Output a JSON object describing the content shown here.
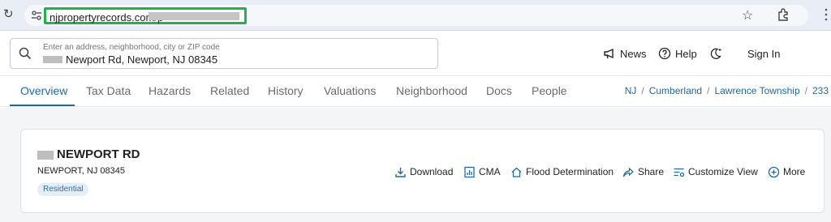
{
  "browser": {
    "url": "njpropertyrecords.com/p"
  },
  "search": {
    "placeholder": "Enter an address, neighborhood, city or ZIP code",
    "value": "Newport Rd, Newport, NJ 08345"
  },
  "header": {
    "news": "News",
    "help": "Help",
    "sign_in": "Sign In"
  },
  "tabs": [
    {
      "label": "Overview",
      "active": true
    },
    {
      "label": "Tax Data"
    },
    {
      "label": "Hazards"
    },
    {
      "label": "Related"
    },
    {
      "label": "History"
    },
    {
      "label": "Valuations"
    },
    {
      "label": "Neighborhood"
    },
    {
      "label": "Docs"
    },
    {
      "label": "People"
    }
  ],
  "breadcrumb": [
    "NJ",
    "Cumberland",
    "Lawrence Township",
    "233"
  ],
  "property": {
    "title": "NEWPORT RD",
    "subtitle": "NEWPORT, NJ 08345",
    "badge": "Residential"
  },
  "actions": {
    "download": "Download",
    "cma": "CMA",
    "flood": "Flood Determination",
    "share": "Share",
    "customize": "Customize View",
    "more": "More"
  },
  "colors": {
    "accent": "#1f6aa5",
    "url_highlight": "#22b14c"
  }
}
